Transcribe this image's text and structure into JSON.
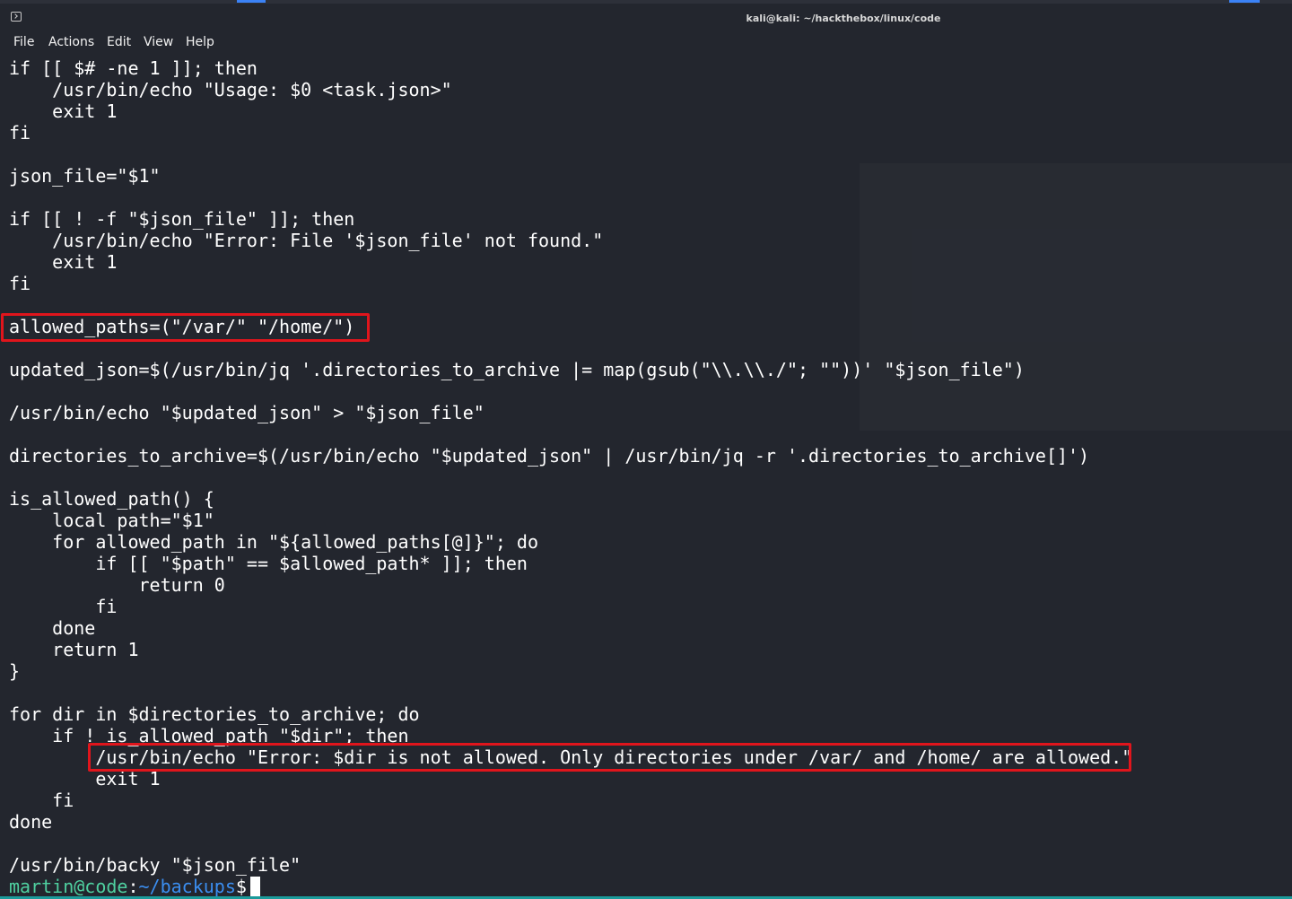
{
  "window": {
    "title": "kali@kali: ~/hackthebox/linux/code"
  },
  "menu": {
    "file": "File",
    "actions": "Actions",
    "edit": "Edit",
    "view": "View",
    "help": "Help"
  },
  "terminal": {
    "lines": [
      "if [[ $# -ne 1 ]]; then",
      "    /usr/bin/echo \"Usage: $0 <task.json>\"",
      "    exit 1",
      "fi",
      "",
      "json_file=\"$1\"",
      "",
      "if [[ ! -f \"$json_file\" ]]; then",
      "    /usr/bin/echo \"Error: File '$json_file' not found.\"",
      "    exit 1",
      "fi",
      "",
      "allowed_paths=(\"/var/\" \"/home/\")",
      "",
      "updated_json=$(/usr/bin/jq '.directories_to_archive |= map(gsub(\"\\\\.\\\\./\"; \"\"))' \"$json_file\")",
      "",
      "/usr/bin/echo \"$updated_json\" > \"$json_file\"",
      "",
      "directories_to_archive=$(/usr/bin/echo \"$updated_json\" | /usr/bin/jq -r '.directories_to_archive[]')",
      "",
      "is_allowed_path() {",
      "    local path=\"$1\"",
      "    for allowed_path in \"${allowed_paths[@]}\"; do",
      "        if [[ \"$path\" == $allowed_path* ]]; then",
      "            return 0",
      "        fi",
      "    done",
      "    return 1",
      "}",
      "",
      "for dir in $directories_to_archive; do",
      "    if ! is_allowed_path \"$dir\"; then",
      "        /usr/bin/echo \"Error: $dir is not allowed. Only directories under /var/ and /home/ are allowed.\"",
      "        exit 1",
      "    fi",
      "done",
      "",
      "/usr/bin/backy \"$json_file\""
    ],
    "prompt": {
      "user_host": "martin@code",
      "separator": ":",
      "path": "~/backups",
      "symbol": "$"
    }
  },
  "colors": {
    "background": "#23262e",
    "text": "#ffffff",
    "highlight_box": "#e0151c",
    "prompt_user": "#4fd0a0",
    "prompt_path": "#3b8ef0"
  }
}
